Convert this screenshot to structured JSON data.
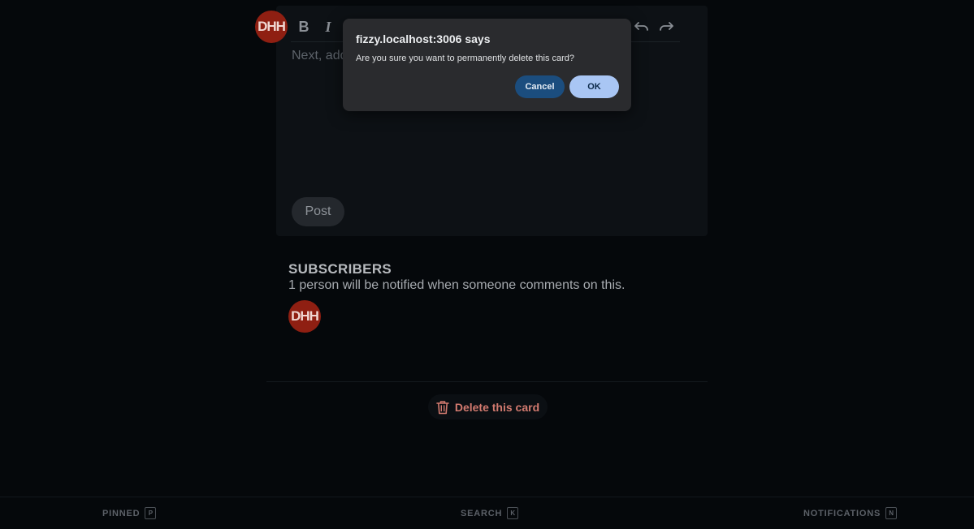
{
  "editor": {
    "avatar_initials": "DHH",
    "toolbar": {
      "bold_label": "B",
      "italic_label": "I",
      "undo_icon": "undo-icon",
      "redo_icon": "redo-icon"
    },
    "placeholder": "Next, add",
    "post_label": "Post"
  },
  "subscribers": {
    "title": "SUBSCRIBERS",
    "description": "1 person will be notified when someone comments on this.",
    "avatar_initials": "DHH"
  },
  "delete": {
    "label": "Delete this card",
    "icon": "trash-icon",
    "color": "#d27a6f"
  },
  "bottom_bar": {
    "pinned": {
      "label": "PINNED",
      "key": "P"
    },
    "search": {
      "label": "SEARCH",
      "key": "K"
    },
    "notifications": {
      "label": "NOTIFICATIONS",
      "key": "N"
    }
  },
  "dialog": {
    "title": "fizzy.localhost:3006 says",
    "message": "Are you sure you want to permanently delete this card?",
    "cancel_label": "Cancel",
    "ok_label": "OK"
  }
}
